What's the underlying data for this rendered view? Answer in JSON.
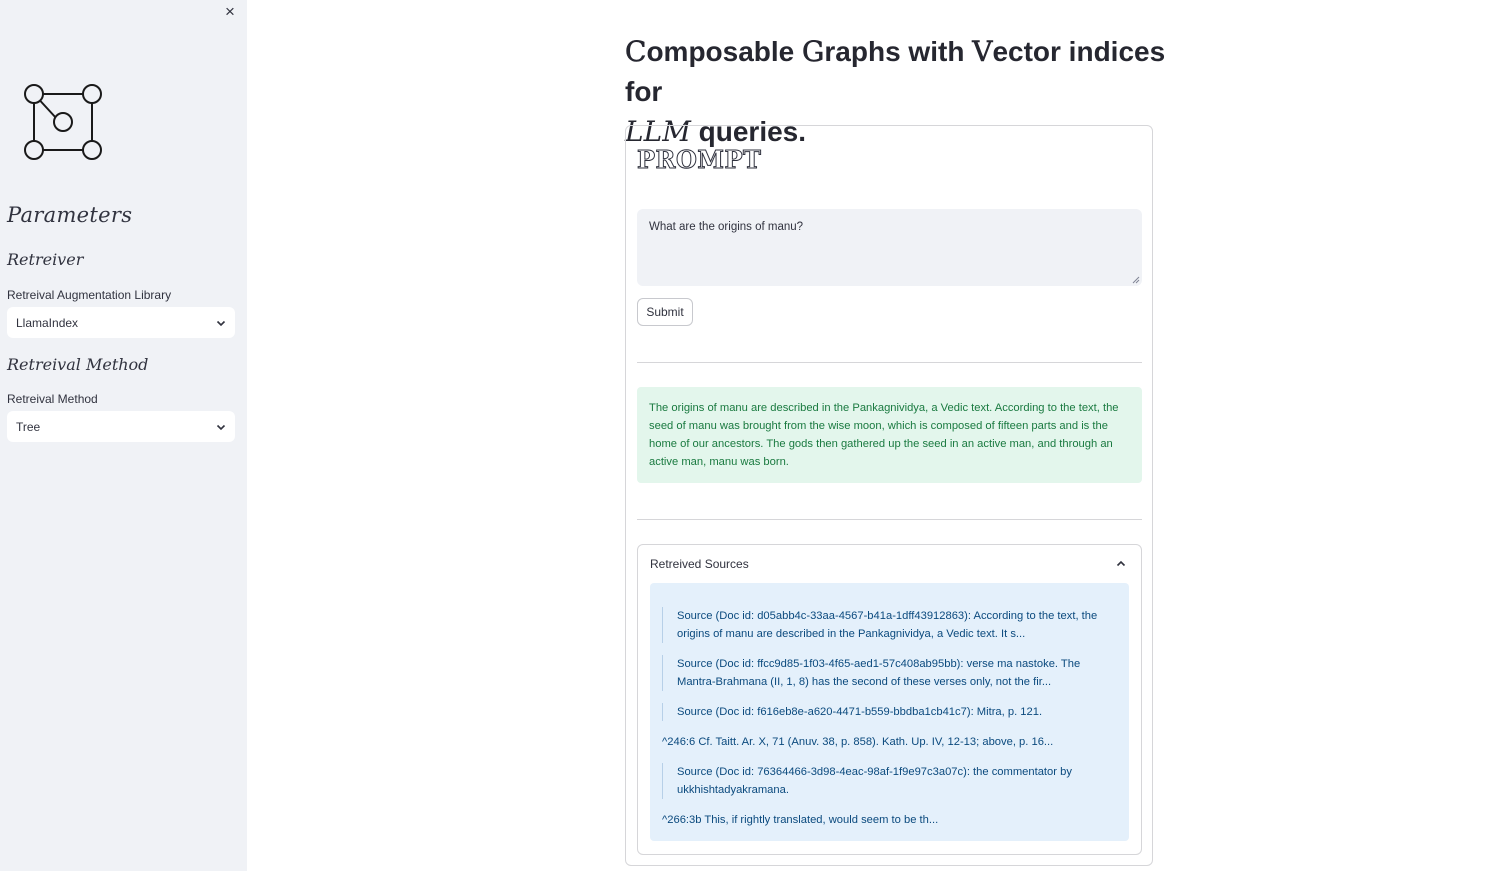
{
  "sidebar": {
    "close_icon": "×",
    "logo_icon": "graph-logo-icon",
    "heading": "Parameters",
    "retriever_heading": "Retreiver",
    "library_label": "Retreival Augmentation Library",
    "library_value": "LlamaIndex",
    "method_heading": "Retreival Method",
    "method_label": "Retreival Method",
    "method_value": "Tree"
  },
  "main": {
    "title_parts": {
      "c": "C",
      "omposable": "omposable ",
      "g": "G",
      "raphs": "raphs with ",
      "v": "V",
      "ector": "ector indices for",
      "llm": "LLM",
      "queries": " queries."
    },
    "prompt_heading": "PROMPT",
    "prompt_value": "What are the origins of manu?",
    "submit_label": "Submit",
    "answer": "The origins of manu are described in the Pankagnividya, a Vedic text. According to the text, the seed of manu was brought from the wise moon, which is composed of fifteen parts and is the home of our ancestors. The gods then gathered up the seed in an active man, and through an active man, manu was born.",
    "sources_title": "Retreived Sources",
    "sources": [
      "Source (Doc id: d05abb4c-33aa-4567-b41a-1dff43912863): According to the text, the origins of manu are described in the Pankagnividya, a Vedic text. It s...",
      "Source (Doc id: ffcc9d85-1f03-4f65-aed1-57c408ab95bb): verse ma nastoke. The Mantra-Brahmana (II, 1, 8) has the second of these verses only, not the fir...",
      "Source (Doc id: f616eb8e-a620-4471-b559-bbdba1cb41c7): Mitra, p. 121.",
      "^246:6 Cf. Taitt. Ar. X, 71 (Anuv. 38, p. 858). Kath. Up. IV, 12-13; above, p. 16...",
      "Source (Doc id: 76364466-3d98-4eac-98af-1f9e97c3a07c): the commentator by ukkhishtadyakramana.",
      "^266:3b This, if rightly translated, would seem to be th..."
    ]
  },
  "colors": {
    "sidebar_bg": "#f0f2f6",
    "answer_bg": "#e3f6ec",
    "answer_text": "#1a7a40",
    "sources_bg": "#e4f0fb",
    "sources_text": "#0b4a7e"
  }
}
